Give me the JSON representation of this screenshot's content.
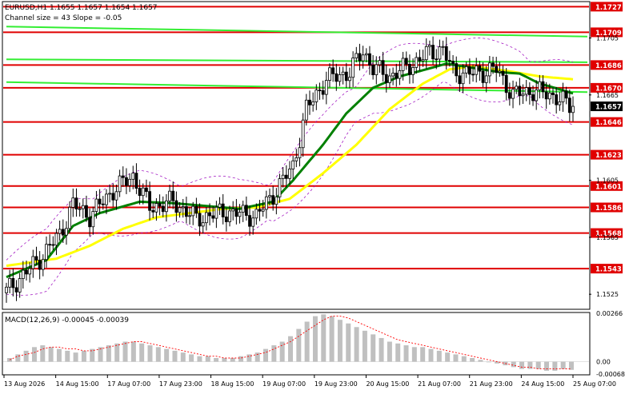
{
  "header": {
    "symbol_line": "EURUSD,H1  1.1655 1.1657 1.1654 1.1657",
    "channel_line": "Channel size = 43 Slope = -0.05"
  },
  "macd": {
    "label": "MACD(12,26,9) -0.00045 -0.00039",
    "axis_ticks": [
      {
        "value": 0.00266,
        "label": "0.00266"
      },
      {
        "value": 0.0,
        "label": "0.00"
      },
      {
        "value": -0.00068,
        "label": "-0.00068"
      }
    ]
  },
  "colors": {
    "resistance_support": "#e00000",
    "ma_fast": "#008000",
    "ma_slow": "#ffff00",
    "channel_line": "#33ee33",
    "bands": "#9900bb",
    "candles": "#000000",
    "macd_hist": "#c0c0c0",
    "macd_signal": "#ff0000",
    "price_badge": "#000000"
  },
  "chart_data": {
    "type": "candlestick",
    "price_axis": {
      "ylim": [
        1.1515,
        1.173
      ],
      "ticks": [
        "1.1705",
        "1.1665",
        "1.1605",
        "1.1565",
        "1.1525"
      ]
    },
    "levels": [
      1.1727,
      1.1709,
      1.1686,
      1.167,
      1.1646,
      1.1623,
      1.1601,
      1.1586,
      1.1568,
      1.1543
    ],
    "current_price": 1.1657,
    "current_price_label": "1.1657",
    "x_labels": [
      "13 Aug 2026",
      "14 Aug 15:00",
      "17 Aug 07:00",
      "17 Aug 23:00",
      "18 Aug 15:00",
      "19 Aug 07:00",
      "19 Aug 23:00",
      "20 Aug 15:00",
      "21 Aug 07:00",
      "21 Aug 23:00",
      "24 Aug 15:00",
      "25 Aug 07:00"
    ],
    "anchors": [
      [
        0,
        1.1527
      ],
      [
        10,
        1.155
      ],
      [
        16,
        1.1567
      ],
      [
        20,
        1.1588
      ],
      [
        25,
        1.158
      ],
      [
        32,
        1.1598
      ],
      [
        38,
        1.1608
      ],
      [
        43,
        1.1586
      ],
      [
        50,
        1.159
      ],
      [
        57,
        1.1578
      ],
      [
        65,
        1.1583
      ],
      [
        75,
        1.158
      ],
      [
        80,
        1.1595
      ],
      [
        86,
        1.1615
      ],
      [
        90,
        1.1655
      ],
      [
        96,
        1.1676
      ],
      [
        103,
        1.1681
      ],
      [
        107,
        1.1696
      ],
      [
        110,
        1.1684
      ],
      [
        115,
        1.1678
      ],
      [
        122,
        1.1687
      ],
      [
        127,
        1.1695
      ],
      [
        131,
        1.1697
      ],
      [
        134,
        1.1681
      ],
      [
        140,
        1.168
      ],
      [
        147,
        1.1683
      ],
      [
        152,
        1.1665
      ],
      [
        158,
        1.1668
      ],
      [
        165,
        1.1664
      ],
      [
        170,
        1.1655
      ]
    ],
    "ma_fast_points": [
      [
        0,
        1.1537
      ],
      [
        12,
        1.1549
      ],
      [
        20,
        1.1573
      ],
      [
        28,
        1.1582
      ],
      [
        40,
        1.159
      ],
      [
        50,
        1.1589
      ],
      [
        60,
        1.1587
      ],
      [
        70,
        1.1585
      ],
      [
        80,
        1.159
      ],
      [
        86,
        1.1605
      ],
      [
        95,
        1.163
      ],
      [
        102,
        1.1652
      ],
      [
        110,
        1.167
      ],
      [
        118,
        1.1678
      ],
      [
        126,
        1.1683
      ],
      [
        132,
        1.1687
      ],
      [
        140,
        1.1684
      ],
      [
        148,
        1.1681
      ],
      [
        154,
        1.168
      ],
      [
        160,
        1.1673
      ],
      [
        166,
        1.1669
      ],
      [
        170,
        1.1666
      ]
    ],
    "ma_slow_points": [
      [
        0,
        1.1545
      ],
      [
        15,
        1.155
      ],
      [
        25,
        1.1559
      ],
      [
        35,
        1.1571
      ],
      [
        45,
        1.1579
      ],
      [
        55,
        1.1582
      ],
      [
        65,
        1.1585
      ],
      [
        75,
        1.1586
      ],
      [
        85,
        1.1592
      ],
      [
        95,
        1.161
      ],
      [
        105,
        1.163
      ],
      [
        115,
        1.1655
      ],
      [
        125,
        1.1673
      ],
      [
        133,
        1.1683
      ],
      [
        140,
        1.1685
      ],
      [
        150,
        1.1682
      ],
      [
        160,
        1.1678
      ],
      [
        170,
        1.1676
      ]
    ],
    "channel_lines": [
      {
        "from": [
          0,
          1.1713
        ],
        "to": [
          170,
          1.1706
        ]
      },
      {
        "from": [
          0,
          1.1674
        ],
        "to": [
          170,
          1.1667
        ]
      },
      {
        "from": [
          0,
          1.169
        ],
        "to": [
          170,
          1.1688
        ]
      }
    ],
    "macd_values": [
      0.0002,
      0.0004,
      0.0006,
      0.0008,
      0.0009,
      0.0008,
      0.0007,
      0.0006,
      0.0005,
      0.0006,
      0.0007,
      0.0008,
      0.0009,
      0.001,
      0.0011,
      0.0011,
      0.001,
      0.0009,
      0.0008,
      0.0007,
      0.0006,
      0.0005,
      0.0004,
      0.0003,
      0.0003,
      0.0002,
      0.0002,
      0.0002,
      0.0003,
      0.0004,
      0.0005,
      0.0007,
      0.0009,
      0.0011,
      0.0014,
      0.0018,
      0.0022,
      0.0025,
      0.0026,
      0.0025,
      0.0023,
      0.0021,
      0.0019,
      0.0017,
      0.0015,
      0.0013,
      0.0011,
      0.001,
      0.0009,
      0.0008,
      0.0008,
      0.0007,
      0.0006,
      0.0005,
      0.0004,
      0.0003,
      0.0002,
      0.0001,
      0.0,
      -0.0001,
      -0.0002,
      -0.0003,
      -0.0004,
      -0.0004,
      -0.0004,
      -0.0005,
      -0.0005,
      -0.0004,
      -0.00045
    ],
    "macd_signal_values": [
      0.0001,
      0.0003,
      0.0004,
      0.0005,
      0.0007,
      0.0008,
      0.0008,
      0.0007,
      0.0007,
      0.0006,
      0.0006,
      0.0007,
      0.0008,
      0.0009,
      0.001,
      0.0011,
      0.0011,
      0.001,
      0.0009,
      0.0008,
      0.0007,
      0.0006,
      0.0005,
      0.0004,
      0.0003,
      0.0003,
      0.0002,
      0.0002,
      0.0002,
      0.0003,
      0.0004,
      0.0005,
      0.0007,
      0.0009,
      0.0011,
      0.0014,
      0.0017,
      0.002,
      0.0023,
      0.0025,
      0.0025,
      0.0024,
      0.0022,
      0.002,
      0.0018,
      0.0016,
      0.0014,
      0.0012,
      0.0011,
      0.001,
      0.0009,
      0.0008,
      0.0007,
      0.0006,
      0.0005,
      0.0004,
      0.0003,
      0.0002,
      0.0001,
      0.0,
      -0.0001,
      -0.0002,
      -0.0003,
      -0.0003,
      -0.0004,
      -0.0004,
      -0.0004,
      -0.0004,
      -0.00039
    ]
  }
}
